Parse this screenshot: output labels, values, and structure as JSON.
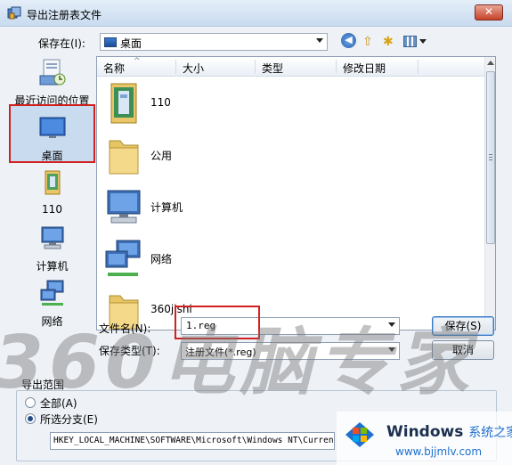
{
  "window": {
    "title": "导出注册表文件",
    "close_label": "✕"
  },
  "toolbar": {
    "save_in_label": "保存在(I):",
    "save_in_value": "桌面",
    "back_glyph": "◀",
    "up_glyph": "⇧",
    "new_folder_glyph": "✱"
  },
  "places": [
    {
      "label": "最近访问的位置",
      "icon": "recent-places-icon"
    },
    {
      "label": "桌面",
      "icon": "desktop-icon",
      "selected": true
    },
    {
      "label": "110",
      "icon": "user-folder-icon"
    },
    {
      "label": "计算机",
      "icon": "computer-icon"
    },
    {
      "label": "网络",
      "icon": "network-icon"
    }
  ],
  "columns": [
    "名称",
    "大小",
    "类型",
    "修改日期"
  ],
  "sort_glyph": "^",
  "files": [
    {
      "name": "110",
      "icon": "user-folder-icon"
    },
    {
      "name": "公用",
      "icon": "folder-icon"
    },
    {
      "name": "计算机",
      "icon": "computer-icon"
    },
    {
      "name": "网络",
      "icon": "network-icon"
    },
    {
      "name": "360jishi",
      "icon": "folder-icon"
    }
  ],
  "form": {
    "filename_label": "文件名(N):",
    "filename_value": "1.reg",
    "filetype_label": "保存类型(T):",
    "filetype_value": "注册文件(*.reg)",
    "save_button": "保存(S)",
    "cancel_button": "取消"
  },
  "range": {
    "title": "导出范围",
    "all_label": "全部(A)",
    "branch_label": "所选分支(E)",
    "selected": "branch",
    "path_value": "HKEY_LOCAL_MACHINE\\SOFTWARE\\Microsoft\\Windows NT\\CurrentVersion"
  },
  "watermark": "360电脑专家",
  "logo": {
    "brand": "Windows",
    "brand_zh": "系统之家",
    "url": "www.bjjmlv.com"
  },
  "colors": {
    "highlight": "#d21f1f",
    "accent": "#1d6fd0"
  }
}
